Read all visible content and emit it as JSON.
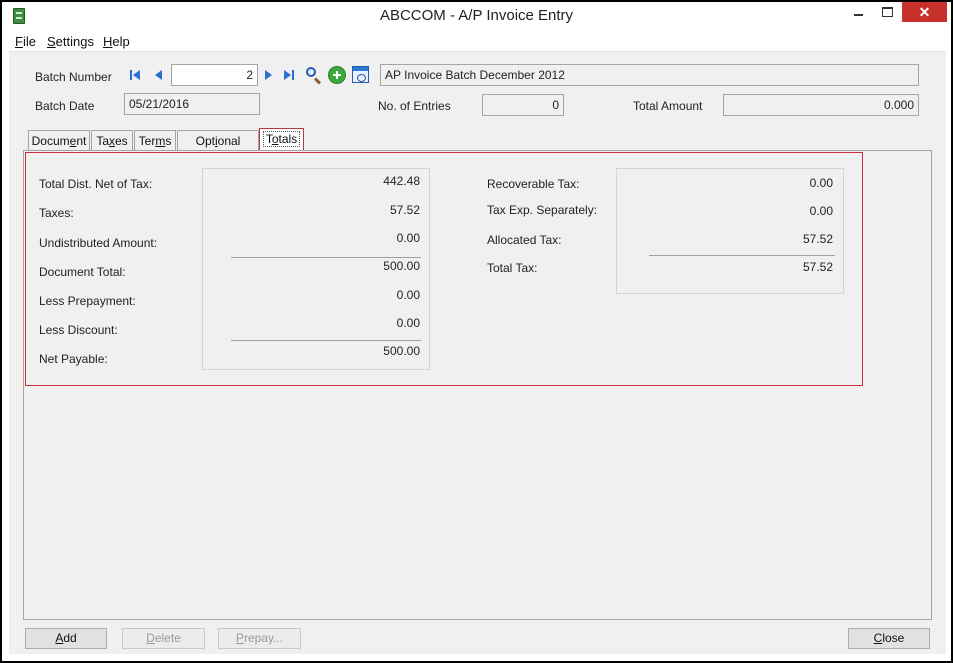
{
  "window": {
    "title": "ABCCOM - A/P Invoice Entry",
    "close_glyph": "✕"
  },
  "menu": [
    {
      "hotkey": "F",
      "rest": "ile"
    },
    {
      "hotkey": "S",
      "rest": "ettings"
    },
    {
      "hotkey": "H",
      "rest": "elp"
    }
  ],
  "header": {
    "batch_number_label": "Batch Number",
    "batch_number_value": "2",
    "batch_description": "AP Invoice Batch December 2012",
    "batch_date_label": "Batch Date",
    "batch_date_value": "05/21/2016",
    "entries_label": "No. of Entries",
    "entries_value": "0",
    "total_amount_label": "Total Amount",
    "total_amount_value": "0.000"
  },
  "tabs": [
    {
      "before": "Docum",
      "hotkey": "e",
      "after": "nt"
    },
    {
      "before": "Ta",
      "hotkey": "x",
      "after": "es"
    },
    {
      "before": "Ter",
      "hotkey": "m",
      "after": "s"
    },
    {
      "before": "Opt",
      "hotkey": "i",
      "after": "onal Fields"
    },
    {
      "before": "T",
      "hotkey": "o",
      "after": "tals"
    }
  ],
  "active_tab": "Totals",
  "totals": {
    "left": [
      {
        "label": "Total Dist. Net of Tax:",
        "value": "442.48"
      },
      {
        "label": "Taxes:",
        "value": "57.52"
      },
      {
        "label": "Undistributed Amount:",
        "value": "0.00"
      },
      {
        "label": "Document Total:",
        "value": "500.00"
      },
      {
        "label": "Less Prepayment:",
        "value": "0.00"
      },
      {
        "label": "Less Discount:",
        "value": "0.00"
      },
      {
        "label": "Net Payable:",
        "value": "500.00"
      }
    ],
    "right": [
      {
        "label": "Recoverable Tax:",
        "value": "0.00"
      },
      {
        "label": "Tax Exp. Separately:",
        "value": "0.00"
      },
      {
        "label": "Allocated Tax:",
        "value": "57.52"
      },
      {
        "label": "Total Tax:",
        "value": "57.52"
      }
    ]
  },
  "buttons": {
    "add": {
      "hotkey": "A",
      "rest": "dd"
    },
    "delete": {
      "hotkey": "D",
      "rest": "elete"
    },
    "prepay": {
      "hotkey": "P",
      "rest": "repay..."
    },
    "close": {
      "hotkey": "C",
      "rest": "lose"
    }
  },
  "colors": {
    "focus_border": "#c8313a",
    "close_button": "#c7302b",
    "nav_arrow": "#2b6fd1"
  }
}
